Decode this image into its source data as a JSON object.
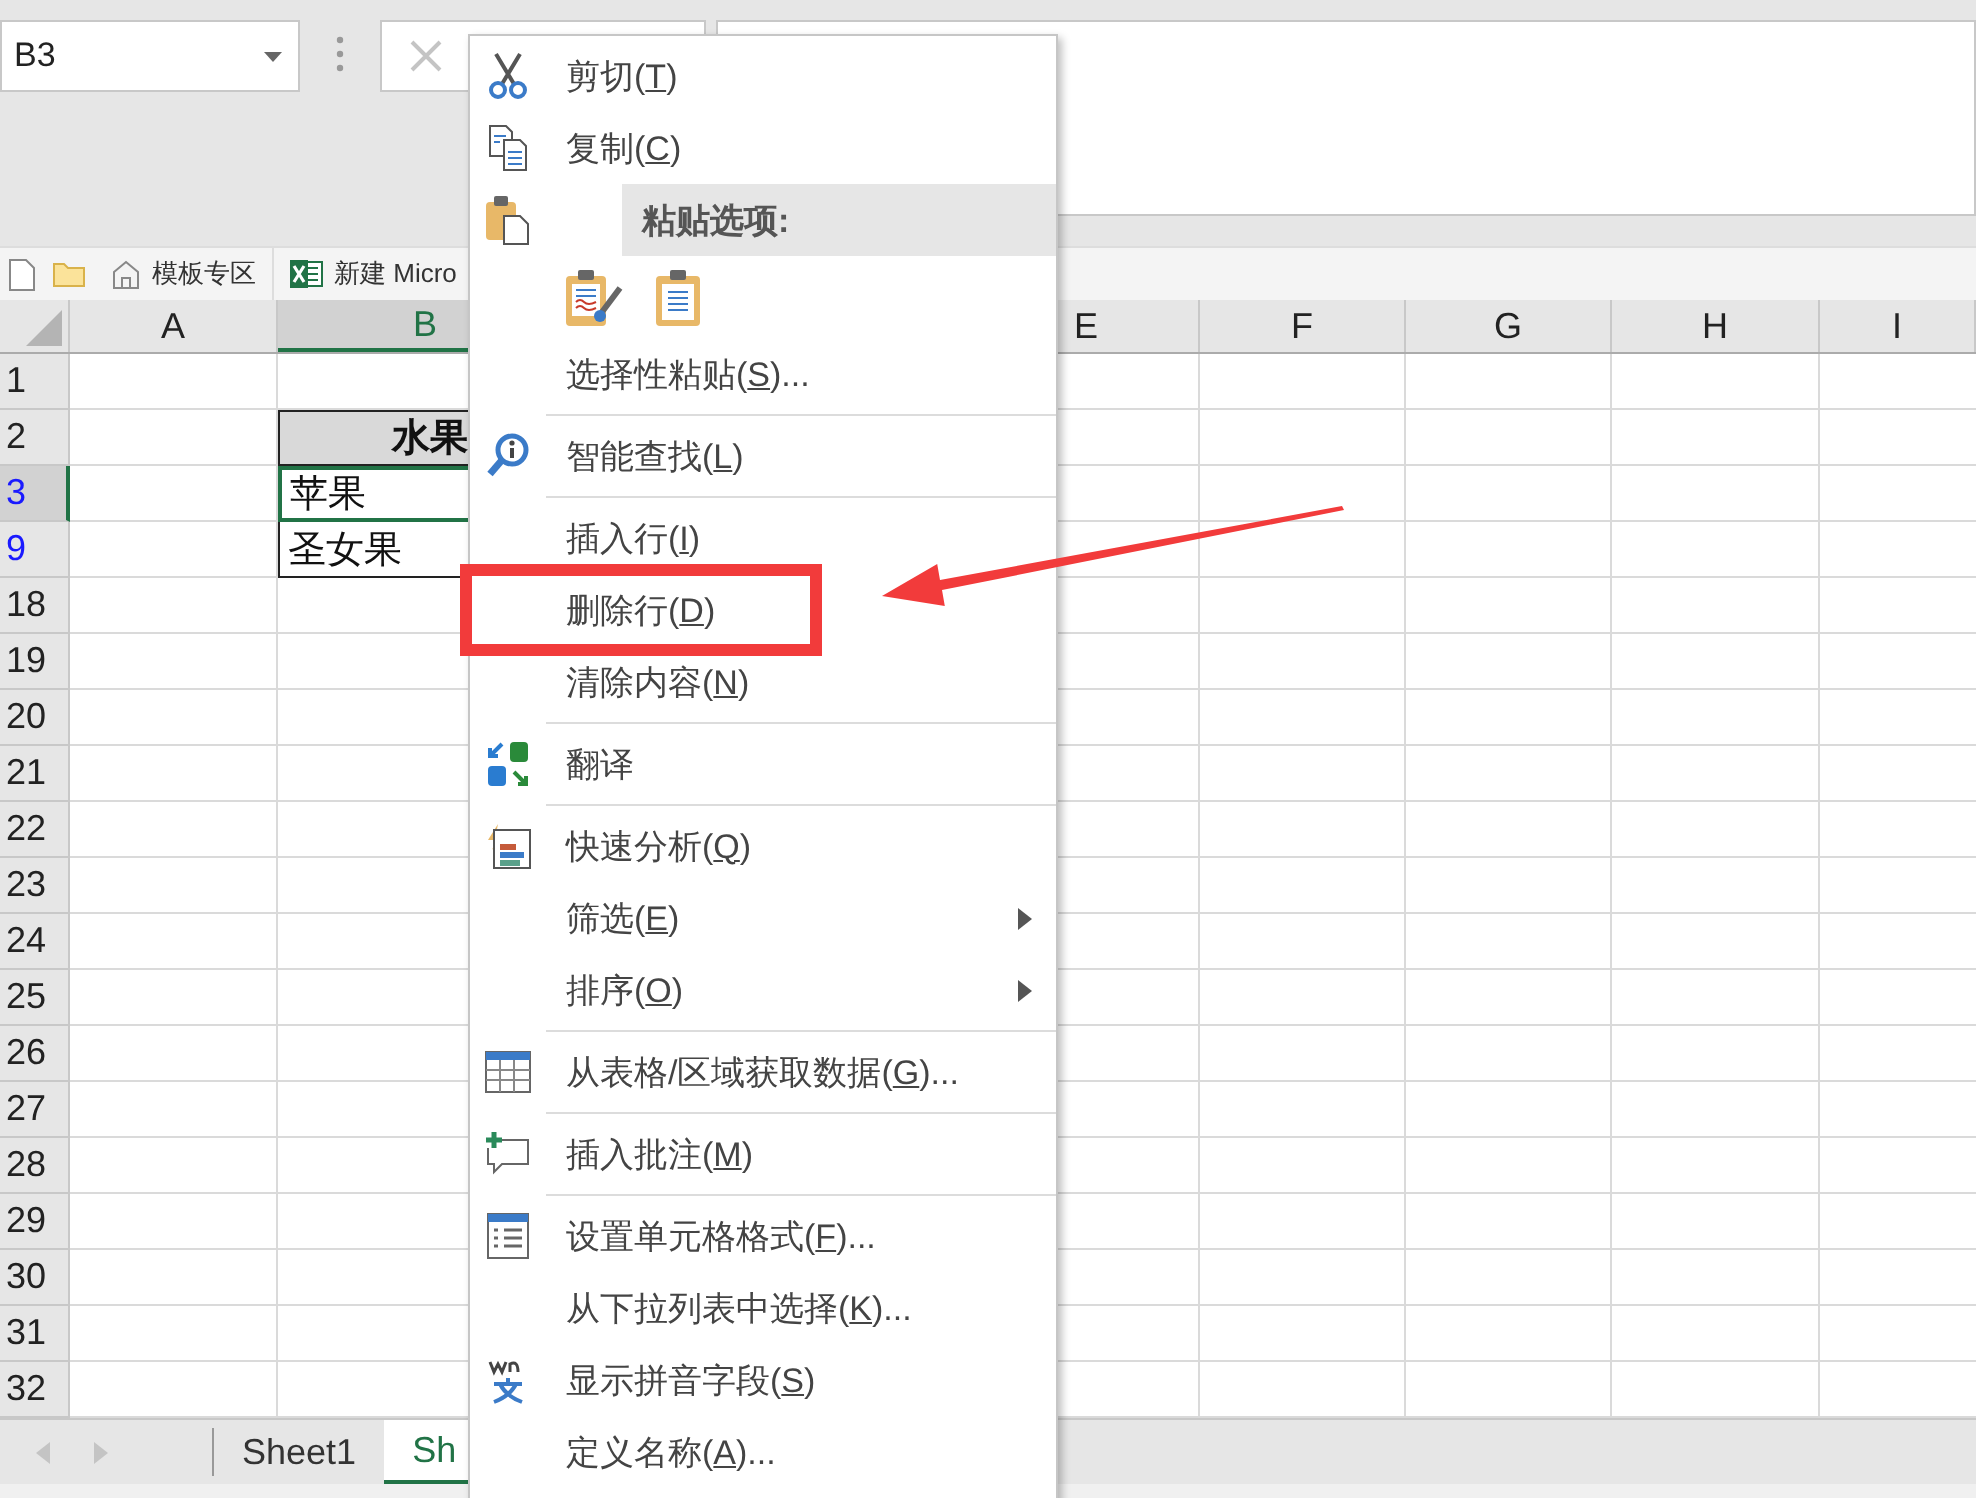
{
  "name_box": {
    "value": "B3"
  },
  "quick_bar": {
    "items": [
      {
        "kind": "file"
      },
      {
        "kind": "folder"
      },
      {
        "kind": "home",
        "label": "模板专区"
      },
      {
        "kind": "excel",
        "label": "新建 Micro"
      }
    ]
  },
  "columns": [
    {
      "label": "A",
      "selected": false
    },
    {
      "label": "B",
      "selected": true
    },
    {
      "label": "E",
      "selected": false
    },
    {
      "label": "F",
      "selected": false
    },
    {
      "label": "G",
      "selected": false
    },
    {
      "label": "H",
      "selected": false
    },
    {
      "label": "I",
      "selected": false
    }
  ],
  "rows": [
    {
      "number": "1",
      "selected": false,
      "filtered": false
    },
    {
      "number": "2",
      "selected": false,
      "filtered": false,
      "b": {
        "text": "水果",
        "kind": "heading",
        "selected": false
      }
    },
    {
      "number": "3",
      "selected": true,
      "filtered": true,
      "b": {
        "text": "苹果",
        "kind": "value",
        "selected": true
      }
    },
    {
      "number": "9",
      "selected": false,
      "filtered": true,
      "b": {
        "text": "圣女果",
        "kind": "value",
        "selected": false
      }
    },
    {
      "number": "18",
      "selected": false,
      "filtered": false
    },
    {
      "number": "19",
      "selected": false,
      "filtered": false
    },
    {
      "number": "20",
      "selected": false,
      "filtered": false
    },
    {
      "number": "21",
      "selected": false,
      "filtered": false
    },
    {
      "number": "22",
      "selected": false,
      "filtered": false
    },
    {
      "number": "23",
      "selected": false,
      "filtered": false
    },
    {
      "number": "24",
      "selected": false,
      "filtered": false
    },
    {
      "number": "25",
      "selected": false,
      "filtered": false
    },
    {
      "number": "26",
      "selected": false,
      "filtered": false
    },
    {
      "number": "27",
      "selected": false,
      "filtered": false
    },
    {
      "number": "28",
      "selected": false,
      "filtered": false
    },
    {
      "number": "29",
      "selected": false,
      "filtered": false
    },
    {
      "number": "30",
      "selected": false,
      "filtered": false
    },
    {
      "number": "31",
      "selected": false,
      "filtered": false
    },
    {
      "number": "32",
      "selected": false,
      "filtered": false
    }
  ],
  "sheet_tabs": [
    {
      "label": "Sheet1",
      "selected": false
    },
    {
      "label": "Sh",
      "selected": true
    }
  ],
  "context_menu": {
    "items": [
      {
        "kind": "cut",
        "text": "剪切(",
        "key": "T",
        "after": ")",
        "submenu": false,
        "highlighted": false
      },
      {
        "kind": "copy",
        "text": "复制(",
        "key": "C",
        "after": ")",
        "submenu": false,
        "highlighted": false
      },
      {
        "kind": "paste-header",
        "text": "粘贴选项:"
      },
      {
        "kind": "paste-options"
      },
      {
        "kind": "command",
        "text": "选择性粘贴(",
        "key": "S",
        "after": ")...",
        "submenu": false,
        "highlighted": false
      },
      {
        "kind": "separator"
      },
      {
        "kind": "lookup",
        "text": "智能查找(",
        "key": "L",
        "after": ")",
        "submenu": false,
        "highlighted": false
      },
      {
        "kind": "separator"
      },
      {
        "kind": "command",
        "text": "插入行(",
        "key": "I",
        "after": ")",
        "submenu": false,
        "highlighted": false
      },
      {
        "kind": "command",
        "text": "删除行(",
        "key": "D",
        "after": ")",
        "submenu": false,
        "highlighted": true
      },
      {
        "kind": "command",
        "text": "清除内容(",
        "key": "N",
        "after": ")",
        "submenu": false,
        "highlighted": false
      },
      {
        "kind": "separator"
      },
      {
        "kind": "translate",
        "text": "翻译",
        "submenu": false,
        "highlighted": false
      },
      {
        "kind": "separator"
      },
      {
        "kind": "quick-analysis",
        "text": "快速分析(",
        "key": "Q",
        "after": ")",
        "submenu": false,
        "highlighted": false
      },
      {
        "kind": "command",
        "text": "筛选(",
        "key": "E",
        "after": ")",
        "submenu": true,
        "highlighted": false
      },
      {
        "kind": "command",
        "text": "排序(",
        "key": "O",
        "after": ")",
        "submenu": true,
        "highlighted": false
      },
      {
        "kind": "separator"
      },
      {
        "kind": "get-data",
        "text": "从表格/区域获取数据(",
        "key": "G",
        "after": ")...",
        "submenu": false,
        "highlighted": false
      },
      {
        "kind": "separator"
      },
      {
        "kind": "comment",
        "text": "插入批注(",
        "key": "M",
        "after": ")",
        "submenu": false,
        "highlighted": false
      },
      {
        "kind": "separator"
      },
      {
        "kind": "format",
        "text": "设置单元格格式(",
        "key": "F",
        "after": ")...",
        "submenu": false,
        "highlighted": false
      },
      {
        "kind": "command",
        "text": "从下拉列表中选择(",
        "key": "K",
        "after": ")...",
        "submenu": false,
        "highlighted": false
      },
      {
        "kind": "pinyin",
        "text": "显示拼音字段(",
        "key": "S",
        "after": ")",
        "submenu": false,
        "highlighted": false
      },
      {
        "kind": "command",
        "text": "定义名称(",
        "key": "A",
        "after": ")...",
        "submenu": false,
        "highlighted": false
      }
    ]
  }
}
